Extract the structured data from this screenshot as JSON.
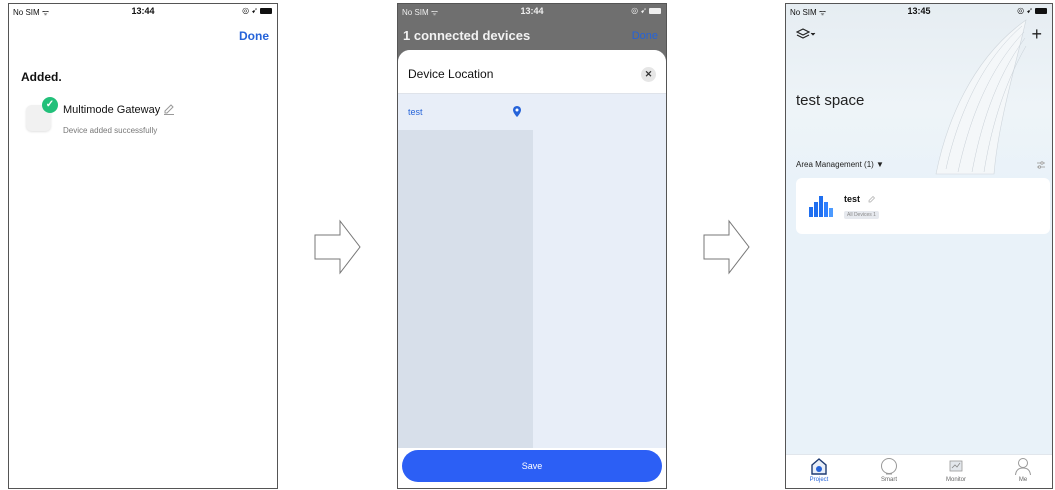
{
  "screen1": {
    "status": {
      "carrier": "No SIM",
      "time": "13:44"
    },
    "done_label": "Done",
    "title": "Added.",
    "device": {
      "name": "Multimode Gateway",
      "subtitle": "Device added successfully",
      "check_color": "#22c07a"
    }
  },
  "screen2": {
    "status": {
      "carrier": "No SIM",
      "time": "13:44"
    },
    "header_title": "1 connected devices",
    "done_label": "Done",
    "sheet_title": "Device Location",
    "rooms": [
      {
        "name": "test",
        "selected": true
      }
    ],
    "save_label": "Save",
    "accent": "#2c5ff5"
  },
  "screen3": {
    "status": {
      "carrier": "No SIM",
      "time": "13:45"
    },
    "space_title": "test space",
    "area_management": "Area Management (1) ▼",
    "area": {
      "name": "test",
      "badge": "All Devices 1"
    },
    "tabs": [
      {
        "label": "Project",
        "active": true
      },
      {
        "label": "Smart",
        "active": false
      },
      {
        "label": "Monitor",
        "active": false
      },
      {
        "label": "Me",
        "active": false
      }
    ]
  }
}
